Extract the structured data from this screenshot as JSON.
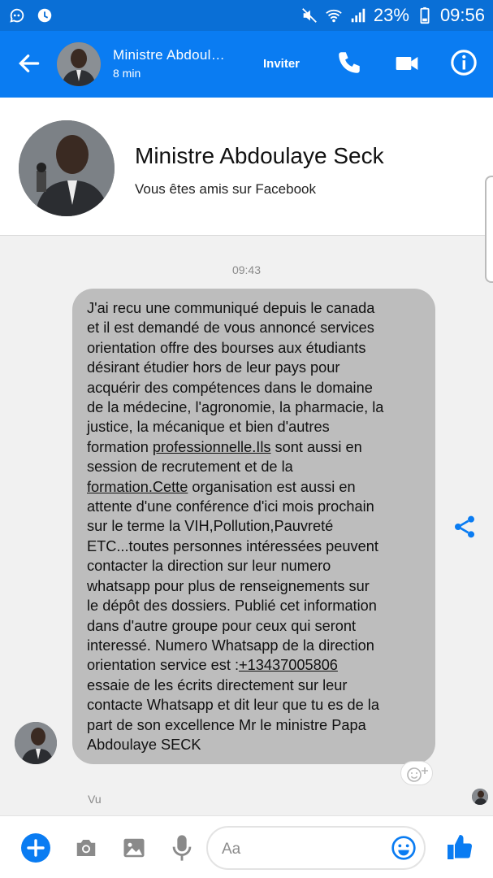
{
  "status_bar": {
    "battery": "23%",
    "time": "09:56"
  },
  "header": {
    "name": "Ministre Abdoul…",
    "status": "8 min",
    "invite_label": "Inviter"
  },
  "profile": {
    "name": "Ministre Abdoulaye Seck",
    "friend_status": "Vous êtes amis sur Facebook"
  },
  "chat": {
    "timestamp": "09:43",
    "message_lines": [
      {
        "text": "J'ai recu une communiqué depuis le canada"
      },
      {
        "text": "et il est demandé de vous annoncé services"
      },
      {
        "text": "orientation offre des bourses aux étudiants"
      },
      {
        "text": "désirant étudier hors de leur pays pour"
      },
      {
        "text": "acquérir des compétences dans le domaine"
      },
      {
        "text": "de la médecine, l'agronomie, la pharmacie, la"
      },
      {
        "text": "justice, la mécanique et bien d'autres"
      },
      {
        "pre": "formation ",
        "link": "professionnelle.Ils",
        "post": " sont aussi en"
      },
      {
        "text": "session de recrutement et de la"
      },
      {
        "link": "formation.Cette",
        "post": " organisation est aussi en"
      },
      {
        "text": "attente d'une conférence d'ici mois prochain"
      },
      {
        "text": "sur le terme la VIH,Pollution,Pauvreté"
      },
      {
        "text": "ETC...toutes personnes intéressées peuvent"
      },
      {
        "text": "contacter la direction sur leur numero"
      },
      {
        "text": "whatsapp pour plus de renseignements sur"
      },
      {
        "text": "le dépôt des dossiers. Publié cet information"
      },
      {
        "text": "dans d'autre groupe pour ceux qui seront"
      },
      {
        "text": "interessé. Numero Whatsapp de la direction"
      },
      {
        "pre": "orientation service est :",
        "link": "+13437005806"
      },
      {
        "text": "essaie de les écrits directement sur leur"
      },
      {
        "text": "contacte Whatsapp et dit leur que tu es de la"
      },
      {
        "text": "part de son excellence Mr le ministre Papa"
      },
      {
        "text": "Abdoulaye SECK"
      }
    ],
    "seen_label": "Vu"
  },
  "composer": {
    "placeholder": "Aa"
  },
  "colors": {
    "brand_blue": "#0a7cf2",
    "status_blue": "#0a6fd6",
    "bubble_grey": "#bdbdbd"
  },
  "icons": [
    "back-arrow-icon",
    "phone-icon",
    "video-camera-icon",
    "info-icon",
    "share-icon",
    "add-reaction-icon",
    "plus-icon",
    "camera-icon",
    "image-icon",
    "microphone-icon",
    "emoji-icon",
    "thumbs-up-icon"
  ]
}
